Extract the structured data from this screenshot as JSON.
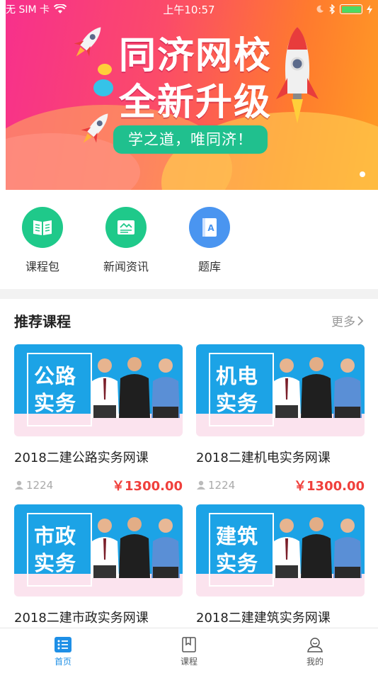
{
  "status_bar": {
    "carrier": "无 SIM 卡",
    "time": "上午10:57"
  },
  "banner": {
    "title_line1": "同济网校",
    "title_line2": "全新升级",
    "slogan": "学之道，唯同济！"
  },
  "quick_menu": [
    {
      "label": "课程包",
      "color": "#1fc98a"
    },
    {
      "label": "新闻资讯",
      "color": "#1fc98a"
    },
    {
      "label": "题库",
      "color": "#4a95f0"
    }
  ],
  "recommended": {
    "title": "推荐课程",
    "more": "更多",
    "courses": [
      {
        "thumb_word_1": "公路",
        "thumb_word_2": "实务",
        "name": "2018二建公路实务网课",
        "count": "1224",
        "price": "￥1300.00"
      },
      {
        "thumb_word_1": "机电",
        "thumb_word_2": "实务",
        "name": "2018二建机电实务网课",
        "count": "1224",
        "price": "￥1300.00"
      },
      {
        "thumb_word_1": "市政",
        "thumb_word_2": "实务",
        "name": "2018二建市政实务网课",
        "count": "",
        "price": ""
      },
      {
        "thumb_word_1": "建筑",
        "thumb_word_2": "实务",
        "name": "2018二建建筑实务网课",
        "count": "",
        "price": ""
      }
    ]
  },
  "tab_bar": [
    {
      "label": "首页",
      "icon": "home-list-icon",
      "active": true
    },
    {
      "label": "课程",
      "icon": "book-icon",
      "active": false
    },
    {
      "label": "我的",
      "icon": "user-icon",
      "active": false
    }
  ],
  "colors": {
    "accent": "#1e8fe6",
    "price": "#f0403c",
    "thumb_blue": "#1ca3e6"
  }
}
